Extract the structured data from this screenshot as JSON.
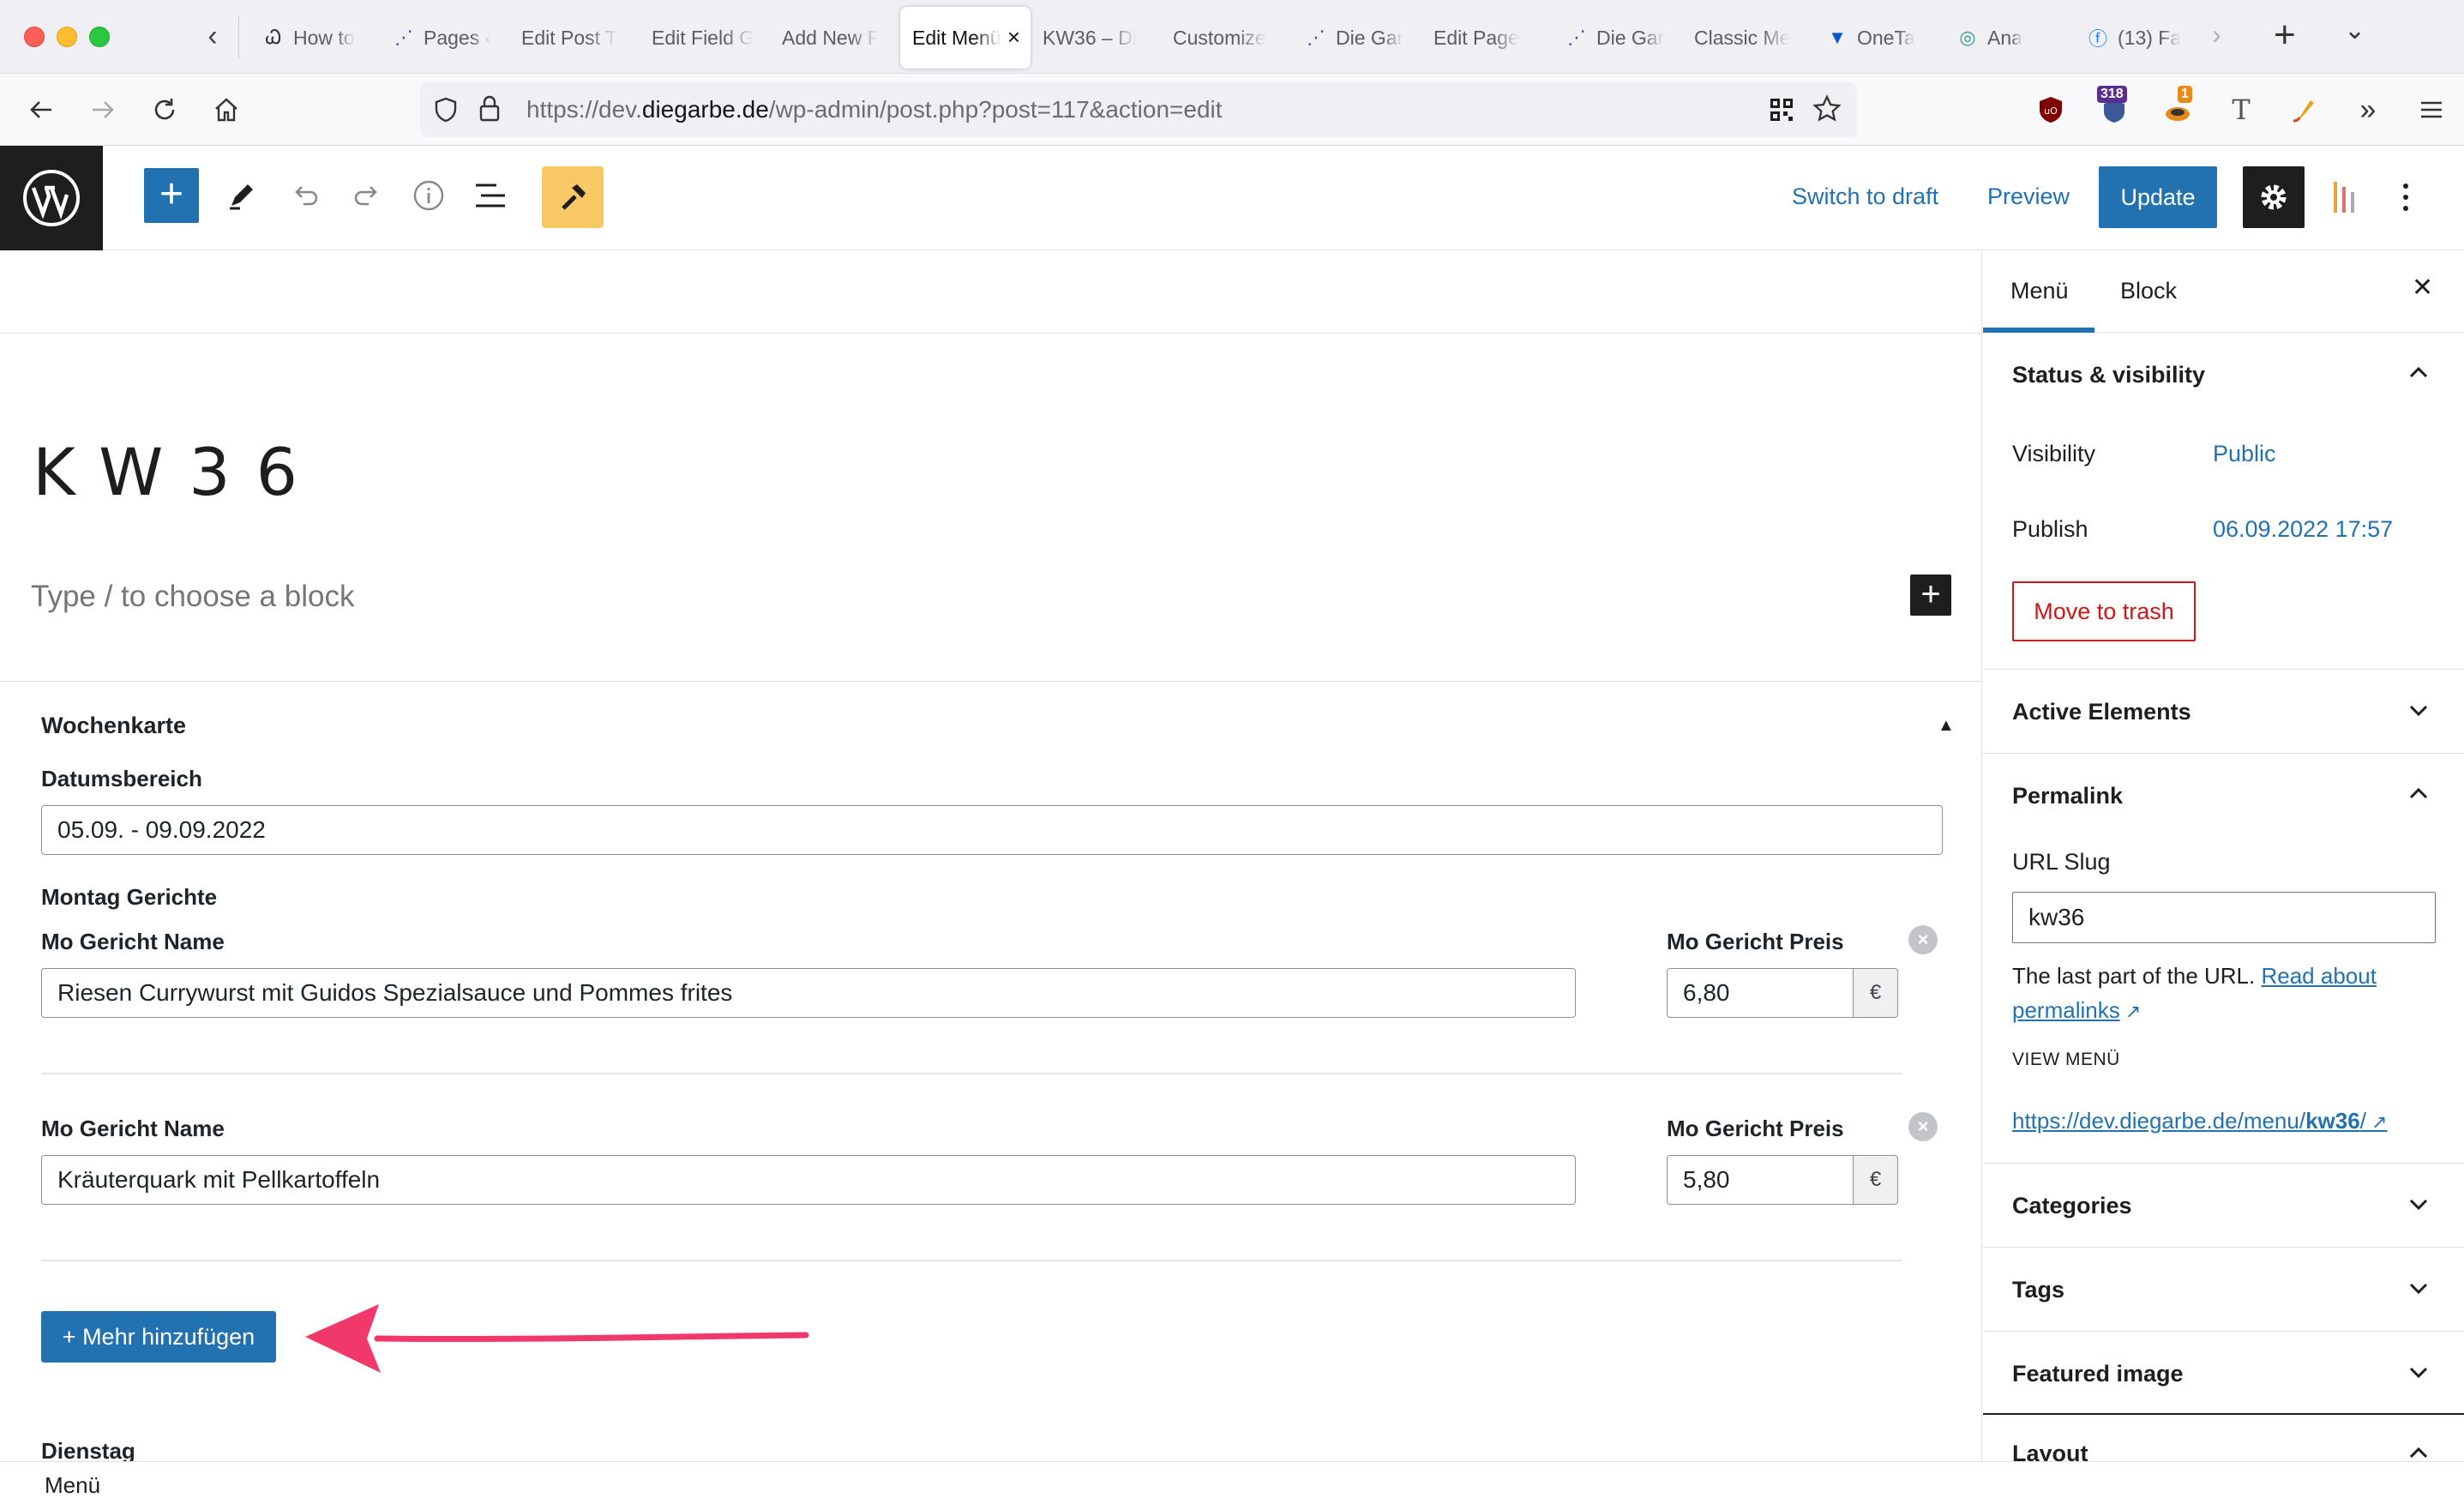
{
  "browser": {
    "tabs": [
      {
        "label": "How to",
        "icon": "acf-icon"
      },
      {
        "label": "Pages ‹",
        "icon": "wp-sparkle-icon"
      },
      {
        "label": "Edit Post T",
        "icon": ""
      },
      {
        "label": "Edit Field G",
        "icon": ""
      },
      {
        "label": "Add New F",
        "icon": ""
      },
      {
        "label": "Edit Menü",
        "icon": "",
        "active": true
      },
      {
        "label": "KW36 – Di",
        "icon": ""
      },
      {
        "label": "Customize",
        "icon": ""
      },
      {
        "label": "Die Gar",
        "icon": "wp-sparkle-icon"
      },
      {
        "label": "Edit Page",
        "icon": ""
      },
      {
        "label": "Die Gar",
        "icon": "wp-sparkle-icon"
      },
      {
        "label": "Classic Me",
        "icon": ""
      },
      {
        "label": "OneTa",
        "icon": "onetab-icon"
      },
      {
        "label": "Ana",
        "icon": "analytics-icon"
      },
      {
        "label": "(13) Fa",
        "icon": "facebook-icon"
      }
    ],
    "url": {
      "scheme": "https://dev.",
      "domain": "diegarbe.de",
      "path": "/wp-admin/post.php?post=117&action=edit"
    },
    "extensions": {
      "badge_318": "318",
      "badge_1": "1"
    }
  },
  "toolbar": {
    "switch_to_draft": "Switch to draft",
    "preview": "Preview",
    "update": "Update"
  },
  "editor": {
    "title": "KW36",
    "placeholder": "Type / to choose a block"
  },
  "metabox": {
    "title": "Wochenkarte",
    "date_label": "Datumsbereich",
    "date_value": "05.09. - 09.09.2022",
    "monday_label": "Montag Gerichte",
    "rows": [
      {
        "name_label": "Mo Gericht Name",
        "name_value": "Riesen Currywurst mit Guidos Spezialsauce und Pommes frites",
        "price_label": "Mo Gericht Preis",
        "price_value": "6,80",
        "currency": "€"
      },
      {
        "name_label": "Mo Gericht Name",
        "name_value": "Kräuterquark mit Pellkartoffeln",
        "price_label": "Mo Gericht Preis",
        "price_value": "5,80",
        "currency": "€"
      }
    ],
    "add_row": "+ Mehr hinzufügen",
    "next_label": "Dienstag"
  },
  "sidebar": {
    "tabs": [
      "Menü",
      "Block"
    ],
    "status": {
      "title": "Status & visibility",
      "visibility_label": "Visibility",
      "visibility_value": "Public",
      "publish_label": "Publish",
      "publish_value": "06.09.2022 17:57",
      "trash": "Move to trash"
    },
    "active_elements": "Active Elements",
    "permalink": {
      "title": "Permalink",
      "slug_label": "URL Slug",
      "slug_value": "kw36",
      "help_text": "The last part of the URL.",
      "help_link": "Read about permalinks",
      "view_head": "VIEW MENÜ",
      "view_url_base": "https://dev.diegarbe.de/menu/",
      "view_url_slug": "kw36",
      "view_url_end": "/"
    },
    "categories": "Categories",
    "tags": "Tags",
    "featured_image": "Featured image",
    "layout": "Layout"
  },
  "statusbar": {
    "breadcrumb": "Menü"
  },
  "colors": {
    "wp_blue": "#2271b1",
    "danger": "#cc1818",
    "annotation": "#f0386b"
  }
}
